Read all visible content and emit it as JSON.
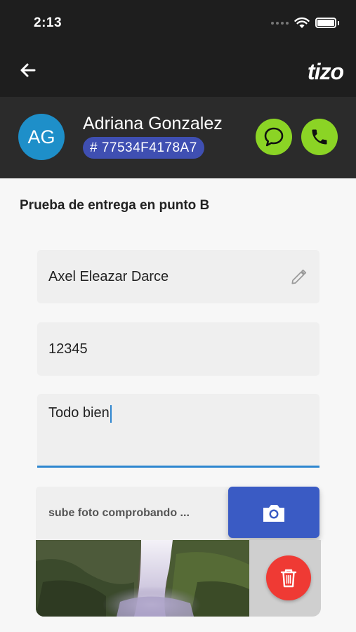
{
  "status_bar": {
    "time": "2:13"
  },
  "app_bar": {
    "logo_text": "tizo"
  },
  "header": {
    "avatar_initials": "AG",
    "user_name": "Adriana Gonzalez",
    "order_id": "# 77534F4178A7",
    "icons": {
      "chat": "chat-bubble-icon",
      "phone": "phone-icon"
    }
  },
  "form": {
    "title": "Prueba de entrega en punto B",
    "receiver_name": "Axel Eleazar Darce",
    "code": "12345",
    "note": "Todo bien",
    "photo_label": "sube foto comprobando ..."
  },
  "colors": {
    "accent_green": "#8bd425",
    "badge_blue": "#3f4fb2",
    "camera_blue": "#3a5bc4",
    "delete_red": "#ef3a34",
    "focus_blue": "#2e86cf"
  }
}
